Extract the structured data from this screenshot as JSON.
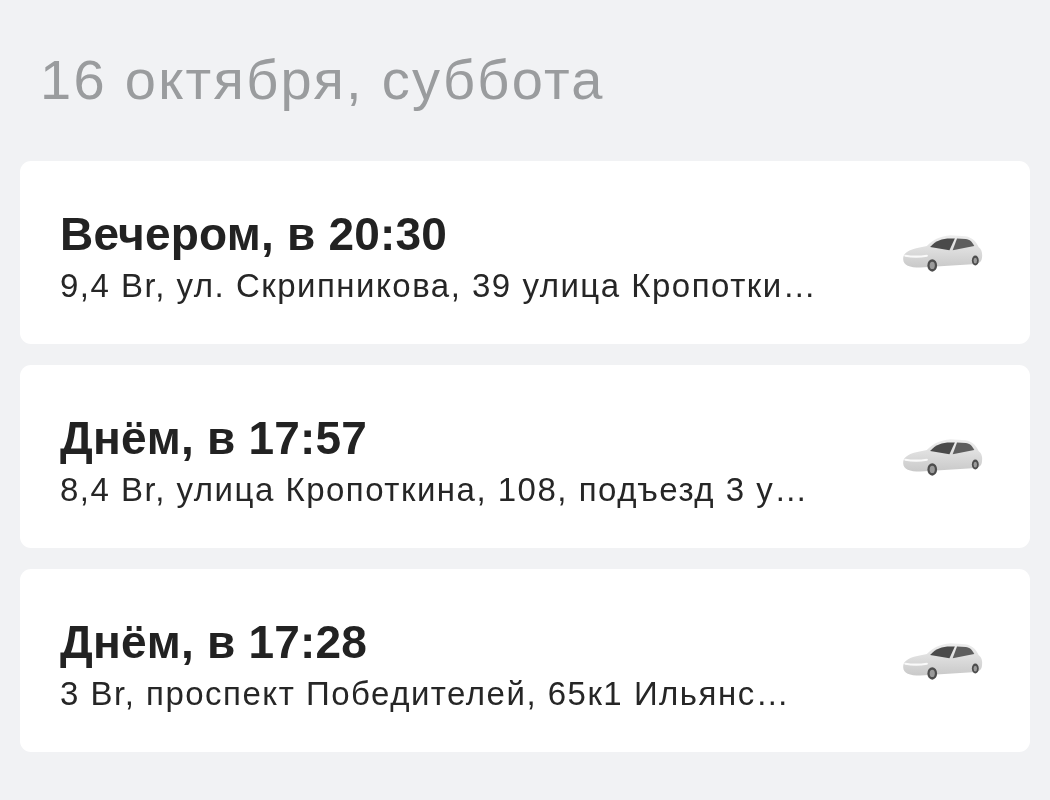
{
  "date_heading": "16 октября, суббота",
  "rides": [
    {
      "title": "Вечером, в 20:30",
      "details": "9,4 Br, ул. Скрипникова, 39 улица Кропотки…"
    },
    {
      "title": "Днём, в 17:57",
      "details": "8,4 Br, улица Кропоткина, 108, подъезд 3 у…"
    },
    {
      "title": "Днём, в 17:28",
      "details": "3 Br, проспект Победителей, 65к1 Ильянс…"
    }
  ]
}
